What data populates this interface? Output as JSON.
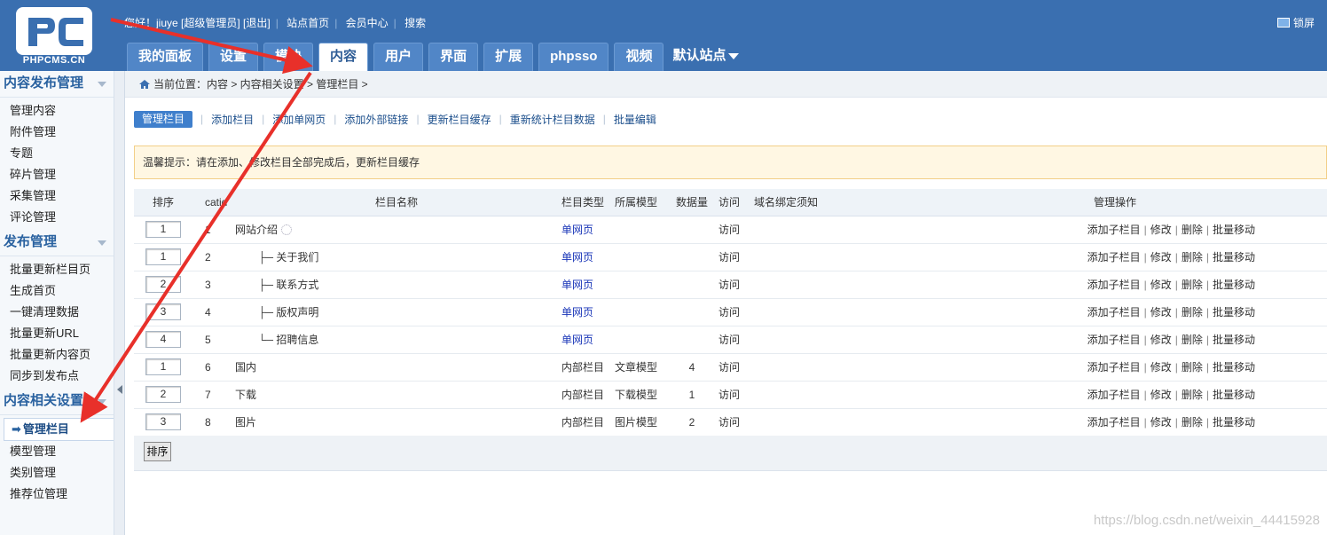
{
  "colors": {
    "header": "#3a6fb0",
    "accent": "#3f7fcc",
    "annotation": "#e8302a"
  },
  "logo": {
    "text": "PHPCMS.CN"
  },
  "topbar": {
    "greeting": "您好！jiuye [超级管理员]",
    "logout": "[退出]",
    "site_home": "站点首页",
    "member_center": "会员中心",
    "search": "搜索",
    "lock": "锁屏"
  },
  "tabs": [
    "我的面板",
    "设置",
    "模块",
    "内容",
    "用户",
    "界面",
    "扩展",
    "phpsso",
    "视频"
  ],
  "active_tab": "内容",
  "site_selector": "默认站点",
  "sidebar": {
    "groups": [
      {
        "title": "内容发布管理",
        "items": [
          "管理内容",
          "附件管理",
          "专题",
          "碎片管理",
          "采集管理",
          "评论管理"
        ]
      },
      {
        "title": "发布管理",
        "items": [
          "批量更新栏目页",
          "生成首页",
          "一键清理数据",
          "批量更新URL",
          "批量更新内容页",
          "同步到发布点"
        ]
      },
      {
        "title": "内容相关设置",
        "items": [
          "管理栏目",
          "模型管理",
          "类别管理",
          "推荐位管理"
        ]
      }
    ],
    "active_item": "管理栏目"
  },
  "breadcrumb": "当前位置：内容 > 内容相关设置 > 管理栏目 >",
  "subnav": {
    "active": "管理栏目",
    "links": [
      "添加栏目",
      "添加单网页",
      "添加外部链接",
      "更新栏目缓存",
      "重新统计栏目数据",
      "批量编辑"
    ]
  },
  "notice": "温馨提示：请在添加、修改栏目全部完成后，更新栏目缓存",
  "table": {
    "headers": [
      "排序",
      "catid",
      "栏目名称",
      "栏目类型",
      "所属模型",
      "数据量",
      "访问",
      "域名绑定须知",
      "管理操作"
    ],
    "rows": [
      {
        "sort": "1",
        "catid": "1",
        "name": "网站介绍",
        "prefix": "",
        "type": "单网页",
        "model": "",
        "count": "",
        "visit": "访问",
        "ops": [
          "添加子栏目",
          "修改",
          "删除",
          "批量移动"
        ]
      },
      {
        "sort": "1",
        "catid": "2",
        "name": "关于我们",
        "prefix": "├─",
        "type": "单网页",
        "model": "",
        "count": "",
        "visit": "访问",
        "ops": [
          "添加子栏目",
          "修改",
          "删除",
          "批量移动"
        ]
      },
      {
        "sort": "2",
        "catid": "3",
        "name": "联系方式",
        "prefix": "├─",
        "type": "单网页",
        "model": "",
        "count": "",
        "visit": "访问",
        "ops": [
          "添加子栏目",
          "修改",
          "删除",
          "批量移动"
        ]
      },
      {
        "sort": "3",
        "catid": "4",
        "name": "版权声明",
        "prefix": "├─",
        "type": "单网页",
        "model": "",
        "count": "",
        "visit": "访问",
        "ops": [
          "添加子栏目",
          "修改",
          "删除",
          "批量移动"
        ]
      },
      {
        "sort": "4",
        "catid": "5",
        "name": "招聘信息",
        "prefix": "└─",
        "type": "单网页",
        "model": "",
        "count": "",
        "visit": "访问",
        "ops": [
          "添加子栏目",
          "修改",
          "删除",
          "批量移动"
        ]
      },
      {
        "sort": "1",
        "catid": "6",
        "name": "国内",
        "prefix": "",
        "type": "内部栏目",
        "model": "文章模型",
        "count": "4",
        "visit": "访问",
        "ops": [
          "添加子栏目",
          "修改",
          "删除",
          "批量移动"
        ]
      },
      {
        "sort": "2",
        "catid": "7",
        "name": "下载",
        "prefix": "",
        "type": "内部栏目",
        "model": "下载模型",
        "count": "1",
        "visit": "访问",
        "ops": [
          "添加子栏目",
          "修改",
          "删除",
          "批量移动"
        ]
      },
      {
        "sort": "3",
        "catid": "8",
        "name": "图片",
        "prefix": "",
        "type": "内部栏目",
        "model": "图片模型",
        "count": "2",
        "visit": "访问",
        "ops": [
          "添加子栏目",
          "修改",
          "删除",
          "批量移动"
        ]
      }
    ]
  },
  "sort_button": "排序",
  "watermark": "https://blog.csdn.net/weixin_44415928"
}
